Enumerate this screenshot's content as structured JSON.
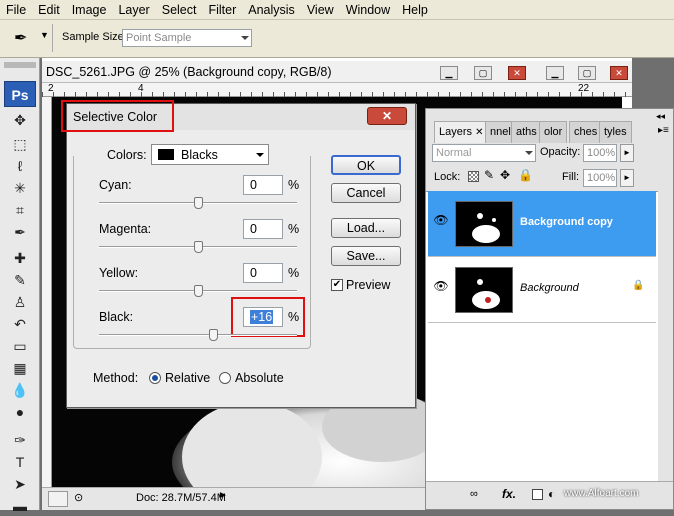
{
  "menu": [
    "File",
    "Edit",
    "Image",
    "Layer",
    "Select",
    "Filter",
    "Analysis",
    "View",
    "Window",
    "Help"
  ],
  "options": {
    "sample_size_label": "Sample Size:",
    "sample_size_value": "Point Sample"
  },
  "toolbox": {
    "logo": "Ps"
  },
  "document": {
    "title": "DSC_5261.JPG @ 25% (Background copy, RGB/8)",
    "ruler_ticks": [
      "2",
      "4",
      "22"
    ],
    "status": "Doc: 28.7M/57.4M"
  },
  "dialog": {
    "title": "Selective Color",
    "colors_label": "Colors:",
    "colors_value": "Blacks",
    "sliders": [
      {
        "label": "Cyan:",
        "value": "0",
        "unit": "%",
        "level": 0
      },
      {
        "label": "Magenta:",
        "value": "0",
        "unit": "%",
        "level": 0
      },
      {
        "label": "Yellow:",
        "value": "0",
        "unit": "%",
        "level": 0
      },
      {
        "label": "Black:",
        "value": "+16",
        "unit": "%",
        "level": 16
      }
    ],
    "buttons": {
      "ok": "OK",
      "cancel": "Cancel",
      "load": "Load...",
      "save": "Save..."
    },
    "preview_label": "Preview",
    "method_label": "Method:",
    "method_relative": "Relative",
    "method_absolute": "Absolute",
    "method_selected": "Relative"
  },
  "layers_panel": {
    "tabs": [
      "Layers",
      "nnels",
      "aths",
      "olor",
      "ches",
      "tyles"
    ],
    "blend_mode": "Normal",
    "opacity_label": "Opacity:",
    "opacity_value": "100%",
    "lock_label": "Lock:",
    "fill_label": "Fill:",
    "fill_value": "100%",
    "layers": [
      {
        "name": "Background copy",
        "selected": true,
        "locked": false
      },
      {
        "name": "Background",
        "selected": false,
        "locked": true
      }
    ],
    "watermark": "www.Alfoart.com"
  },
  "colors": {
    "selection_blue": "#3d9bf0",
    "highlight_red": "#e01010"
  }
}
